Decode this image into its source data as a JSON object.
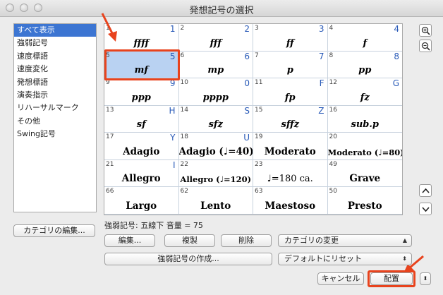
{
  "window": {
    "title": "発想記号の選択"
  },
  "categories": [
    {
      "label": "すべて表示",
      "selected": true
    },
    {
      "label": "強弱記号"
    },
    {
      "label": "速度標語"
    },
    {
      "label": "速度変化"
    },
    {
      "label": "発想標語"
    },
    {
      "label": "演奏指示"
    },
    {
      "label": "リハーサルマーク"
    },
    {
      "label": "その他"
    },
    {
      "label": "Swing記号"
    }
  ],
  "grid_cells": [
    {
      "num": "1",
      "key": "1",
      "symbol": "ffff",
      "style": "dyn"
    },
    {
      "num": "2",
      "key": "2",
      "symbol": "fff",
      "style": "dyn"
    },
    {
      "num": "3",
      "key": "3",
      "symbol": "ff",
      "style": "dyn"
    },
    {
      "num": "4",
      "key": "4",
      "symbol": "f",
      "style": "dyn"
    },
    {
      "num": "5",
      "key": "5",
      "symbol": "mf",
      "style": "dyn",
      "selected": true
    },
    {
      "num": "6",
      "key": "6",
      "symbol": "mp",
      "style": "dyn"
    },
    {
      "num": "7",
      "key": "7",
      "symbol": "p",
      "style": "dyn"
    },
    {
      "num": "8",
      "key": "8",
      "symbol": "pp",
      "style": "dyn"
    },
    {
      "num": "9",
      "key": "9",
      "symbol": "ppp",
      "style": "dyn"
    },
    {
      "num": "10",
      "key": "0",
      "symbol": "pppp",
      "style": "dyn"
    },
    {
      "num": "11",
      "key": "F",
      "symbol": "fp",
      "style": "dyn"
    },
    {
      "num": "12",
      "key": "G",
      "symbol": "fz",
      "style": "dyn"
    },
    {
      "num": "13",
      "key": "H",
      "symbol": "sf",
      "style": "dyn"
    },
    {
      "num": "14",
      "key": "S",
      "symbol": "sfz",
      "style": "dyn"
    },
    {
      "num": "15",
      "key": "Z",
      "symbol": "sffz",
      "style": "dyn"
    },
    {
      "num": "16",
      "key": "",
      "symbol": "sub.p",
      "style": "dyn"
    },
    {
      "num": "17",
      "key": "Y",
      "symbol": "Adagio",
      "style": "tempo"
    },
    {
      "num": "18",
      "key": "U",
      "symbol": "Adagio (♩=40)",
      "style": "tempo"
    },
    {
      "num": "19",
      "key": "",
      "symbol": "Moderato",
      "style": "tempo"
    },
    {
      "num": "20",
      "key": "",
      "symbol": "Moderato (♩=80)",
      "style": "tempo small"
    },
    {
      "num": "21",
      "key": "I",
      "symbol": "Allegro",
      "style": "tempo"
    },
    {
      "num": "22",
      "key": "",
      "symbol": "Allegro (♩=120)",
      "style": "tempo small"
    },
    {
      "num": "23",
      "key": "",
      "symbol": "♩=180 ca.",
      "style": "plain"
    },
    {
      "num": "49",
      "key": "",
      "symbol": "Grave",
      "style": "tempo"
    },
    {
      "num": "66",
      "key": "",
      "symbol": "Largo",
      "style": "tempo"
    },
    {
      "num": "62",
      "key": "",
      "symbol": "Lento",
      "style": "tempo"
    },
    {
      "num": "63",
      "key": "",
      "symbol": "Maestoso",
      "style": "tempo"
    },
    {
      "num": "50",
      "key": "",
      "symbol": "Presto",
      "style": "tempo"
    }
  ],
  "status": {
    "text": "強弱記号: 五線下 音量 = 75"
  },
  "buttons": {
    "edit_category": "カテゴリの編集...",
    "edit": "編集...",
    "duplicate": "複製",
    "delete": "削除",
    "create": "強弱記号の作成...",
    "change_category": "カテゴリの変更",
    "reset_default": "デフォルトにリセット",
    "cancel": "キャンセル",
    "place": "配置"
  },
  "colors": {
    "selection_blue": "#3c75d2",
    "cell_selected": "#b9d2f2",
    "annotation_red": "#e8431d"
  }
}
